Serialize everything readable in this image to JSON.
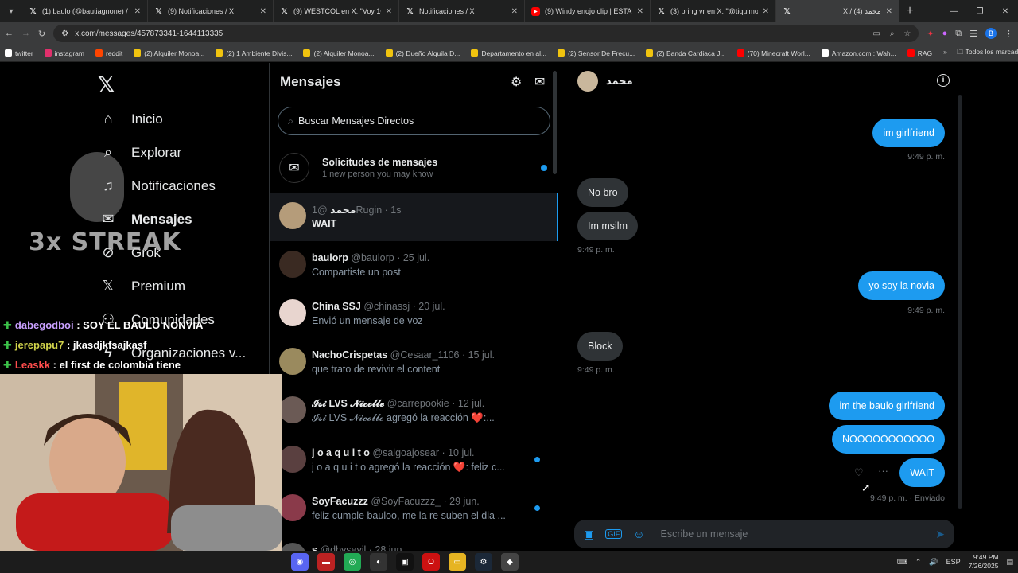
{
  "browser": {
    "tabs": [
      {
        "label": "(1) baulo (@bautiagnone) / X",
        "icon": "x-logo-icon"
      },
      {
        "label": "(9) Notificaciones / X",
        "icon": "x-logo-icon"
      },
      {
        "label": "(9) WESTCOL en X: \"Voy 100Mil",
        "icon": "x-logo-icon"
      },
      {
        "label": "Notificaciones / X",
        "icon": "x-logo-icon"
      },
      {
        "label": "(9) Windy enojo clip | ESTAN JU",
        "icon": "youtube-icon"
      },
      {
        "label": "(3) pring vr en X: \"@tiquimoren",
        "icon": "x-logo-icon"
      },
      {
        "label": "X / محمد (4)",
        "icon": "x-logo-icon"
      }
    ],
    "url": "x.com/messages/457873341-1644113335",
    "bookmarks": [
      {
        "label": "twitter",
        "color": "#ffffff"
      },
      {
        "label": "instagram",
        "color": "#e1306c"
      },
      {
        "label": "reddit",
        "color": "#ff4500"
      },
      {
        "label": "(2) Alquiler Monoa...",
        "color": "#f1c40f"
      },
      {
        "label": "(2) 1 Ambiente Divis...",
        "color": "#f1c40f"
      },
      {
        "label": "(2) Alquiler Monoa...",
        "color": "#f1c40f"
      },
      {
        "label": "(2) Dueño Alquila D...",
        "color": "#f1c40f"
      },
      {
        "label": "Departamento en al...",
        "color": "#f1c40f"
      },
      {
        "label": "(2) Sensor De Frecu...",
        "color": "#f1c40f"
      },
      {
        "label": "(2) Banda Cardiaca J...",
        "color": "#f1c40f"
      },
      {
        "label": "(70) Minecraft Worl...",
        "color": "#ff0000"
      },
      {
        "label": "Amazon.com : Wah...",
        "color": "#ffffff"
      },
      {
        "label": "RAG",
        "color": "#ff0000"
      }
    ],
    "all_bookmarks": "Todos los marcadores",
    "more_bookmarks": "»",
    "profile_initial": "B"
  },
  "nav": {
    "items": [
      {
        "label": "Inicio",
        "icon": "home-icon"
      },
      {
        "label": "Explorar",
        "icon": "search-icon"
      },
      {
        "label": "Notificaciones",
        "icon": "bell-icon"
      },
      {
        "label": "Mensajes",
        "icon": "mail-icon"
      },
      {
        "label": "Grok",
        "icon": "grok-icon"
      },
      {
        "label": "Premium",
        "icon": "x-logo-icon"
      },
      {
        "label": "Comunidades",
        "icon": "people-icon"
      },
      {
        "label": "Organizaciones v...",
        "icon": "lightning-icon"
      }
    ]
  },
  "messages": {
    "title": "Mensajes",
    "search_placeholder": "Buscar Mensajes Directos",
    "requests": {
      "title": "Solicitudes de mensajes",
      "subtitle": "1 new person you may know"
    },
    "conversations": [
      {
        "name": "محمد",
        "handle": "@1Rugin · 1s",
        "preview": "WAIT",
        "color": "#b59c7a",
        "unread": false,
        "selected": true
      },
      {
        "name": "baulorp",
        "handle": "@baulorp · 25 jul.",
        "preview": "Compartiste un post",
        "color": "#3a2a22",
        "unread": false,
        "selected": false
      },
      {
        "name": "China SSJ",
        "handle": "@chinassj · 20 jul.",
        "preview": "Envió un mensaje de voz",
        "color": "#e8d5cf",
        "unread": false,
        "selected": false
      },
      {
        "name": "NachoCrispetas",
        "handle": "@Cesaar_1106 · 15 jul.",
        "preview": "que trato de revivir el content",
        "color": "#9a8a5e",
        "unread": false,
        "selected": false
      },
      {
        "name": "𝓘𝓼𝓲 LVS 𝓝𝓲𝓬𝓸𝓵𝓵𝓮",
        "handle": "@carrepookie · 12 jul.",
        "preview": "𝓘𝓼𝓲 LVS 𝓝𝓲𝓬𝓸𝓵𝓵𝓮 agregó la reacción ❤️:...",
        "color": "#6b5a55",
        "unread": false,
        "selected": false
      },
      {
        "name": "j o a q u i t o",
        "handle": "@salgoajosear · 10 jul.",
        "preview": "j o a q u i t o agregó la reacción ❤️: feliz c...",
        "color": "#5a4040",
        "unread": true,
        "selected": false
      },
      {
        "name": "SoyFacuzzz",
        "handle": "@SoyFacuzzz_ · 29 jun.",
        "preview": "feliz cumple bauloo, me la re suben el dia ...",
        "color": "#8a3a4a",
        "unread": true,
        "selected": false
      },
      {
        "name": "s",
        "handle": "@dbyseyil · 28 jun.",
        "preview": "",
        "color": "#555555",
        "unread": false,
        "selected": false
      }
    ]
  },
  "chat": {
    "contact_name": "محمد",
    "messages": [
      {
        "text": "im girlfriend",
        "dir": "out"
      },
      {
        "text": "No bro",
        "dir": "in"
      },
      {
        "text": "Im msilm",
        "dir": "in"
      },
      {
        "text": "yo soy la novia",
        "dir": "out"
      },
      {
        "text": "Block",
        "dir": "in"
      },
      {
        "text": "im the baulo girlfriend",
        "dir": "out"
      },
      {
        "text": "NOOOOOOOOOOO",
        "dir": "out"
      },
      {
        "text": "WAIT",
        "dir": "out"
      }
    ],
    "timestamps": [
      "9:49 p. m.",
      "9:49 p. m.",
      "9:49 p. m.",
      "9:49 p. m.",
      "9:49 p. m.",
      "9:49 p. m. · Enviado"
    ],
    "composer_placeholder": "Escribe un mensaje"
  },
  "overlay": {
    "streak": "3x STREAK",
    "chat_lines": [
      {
        "user": "dabegodboi",
        "msg": ": SOY EL BAULO NONVIA"
      },
      {
        "user": "jerepapu7",
        "msg": ": jkasdjkfsajkasf"
      },
      {
        "user": "Leaskk",
        "msg": ": el first de colombia tiene"
      }
    ]
  },
  "taskbar": {
    "time": "9:49 PM",
    "date": "7/26/2025",
    "lang": "ESP"
  }
}
